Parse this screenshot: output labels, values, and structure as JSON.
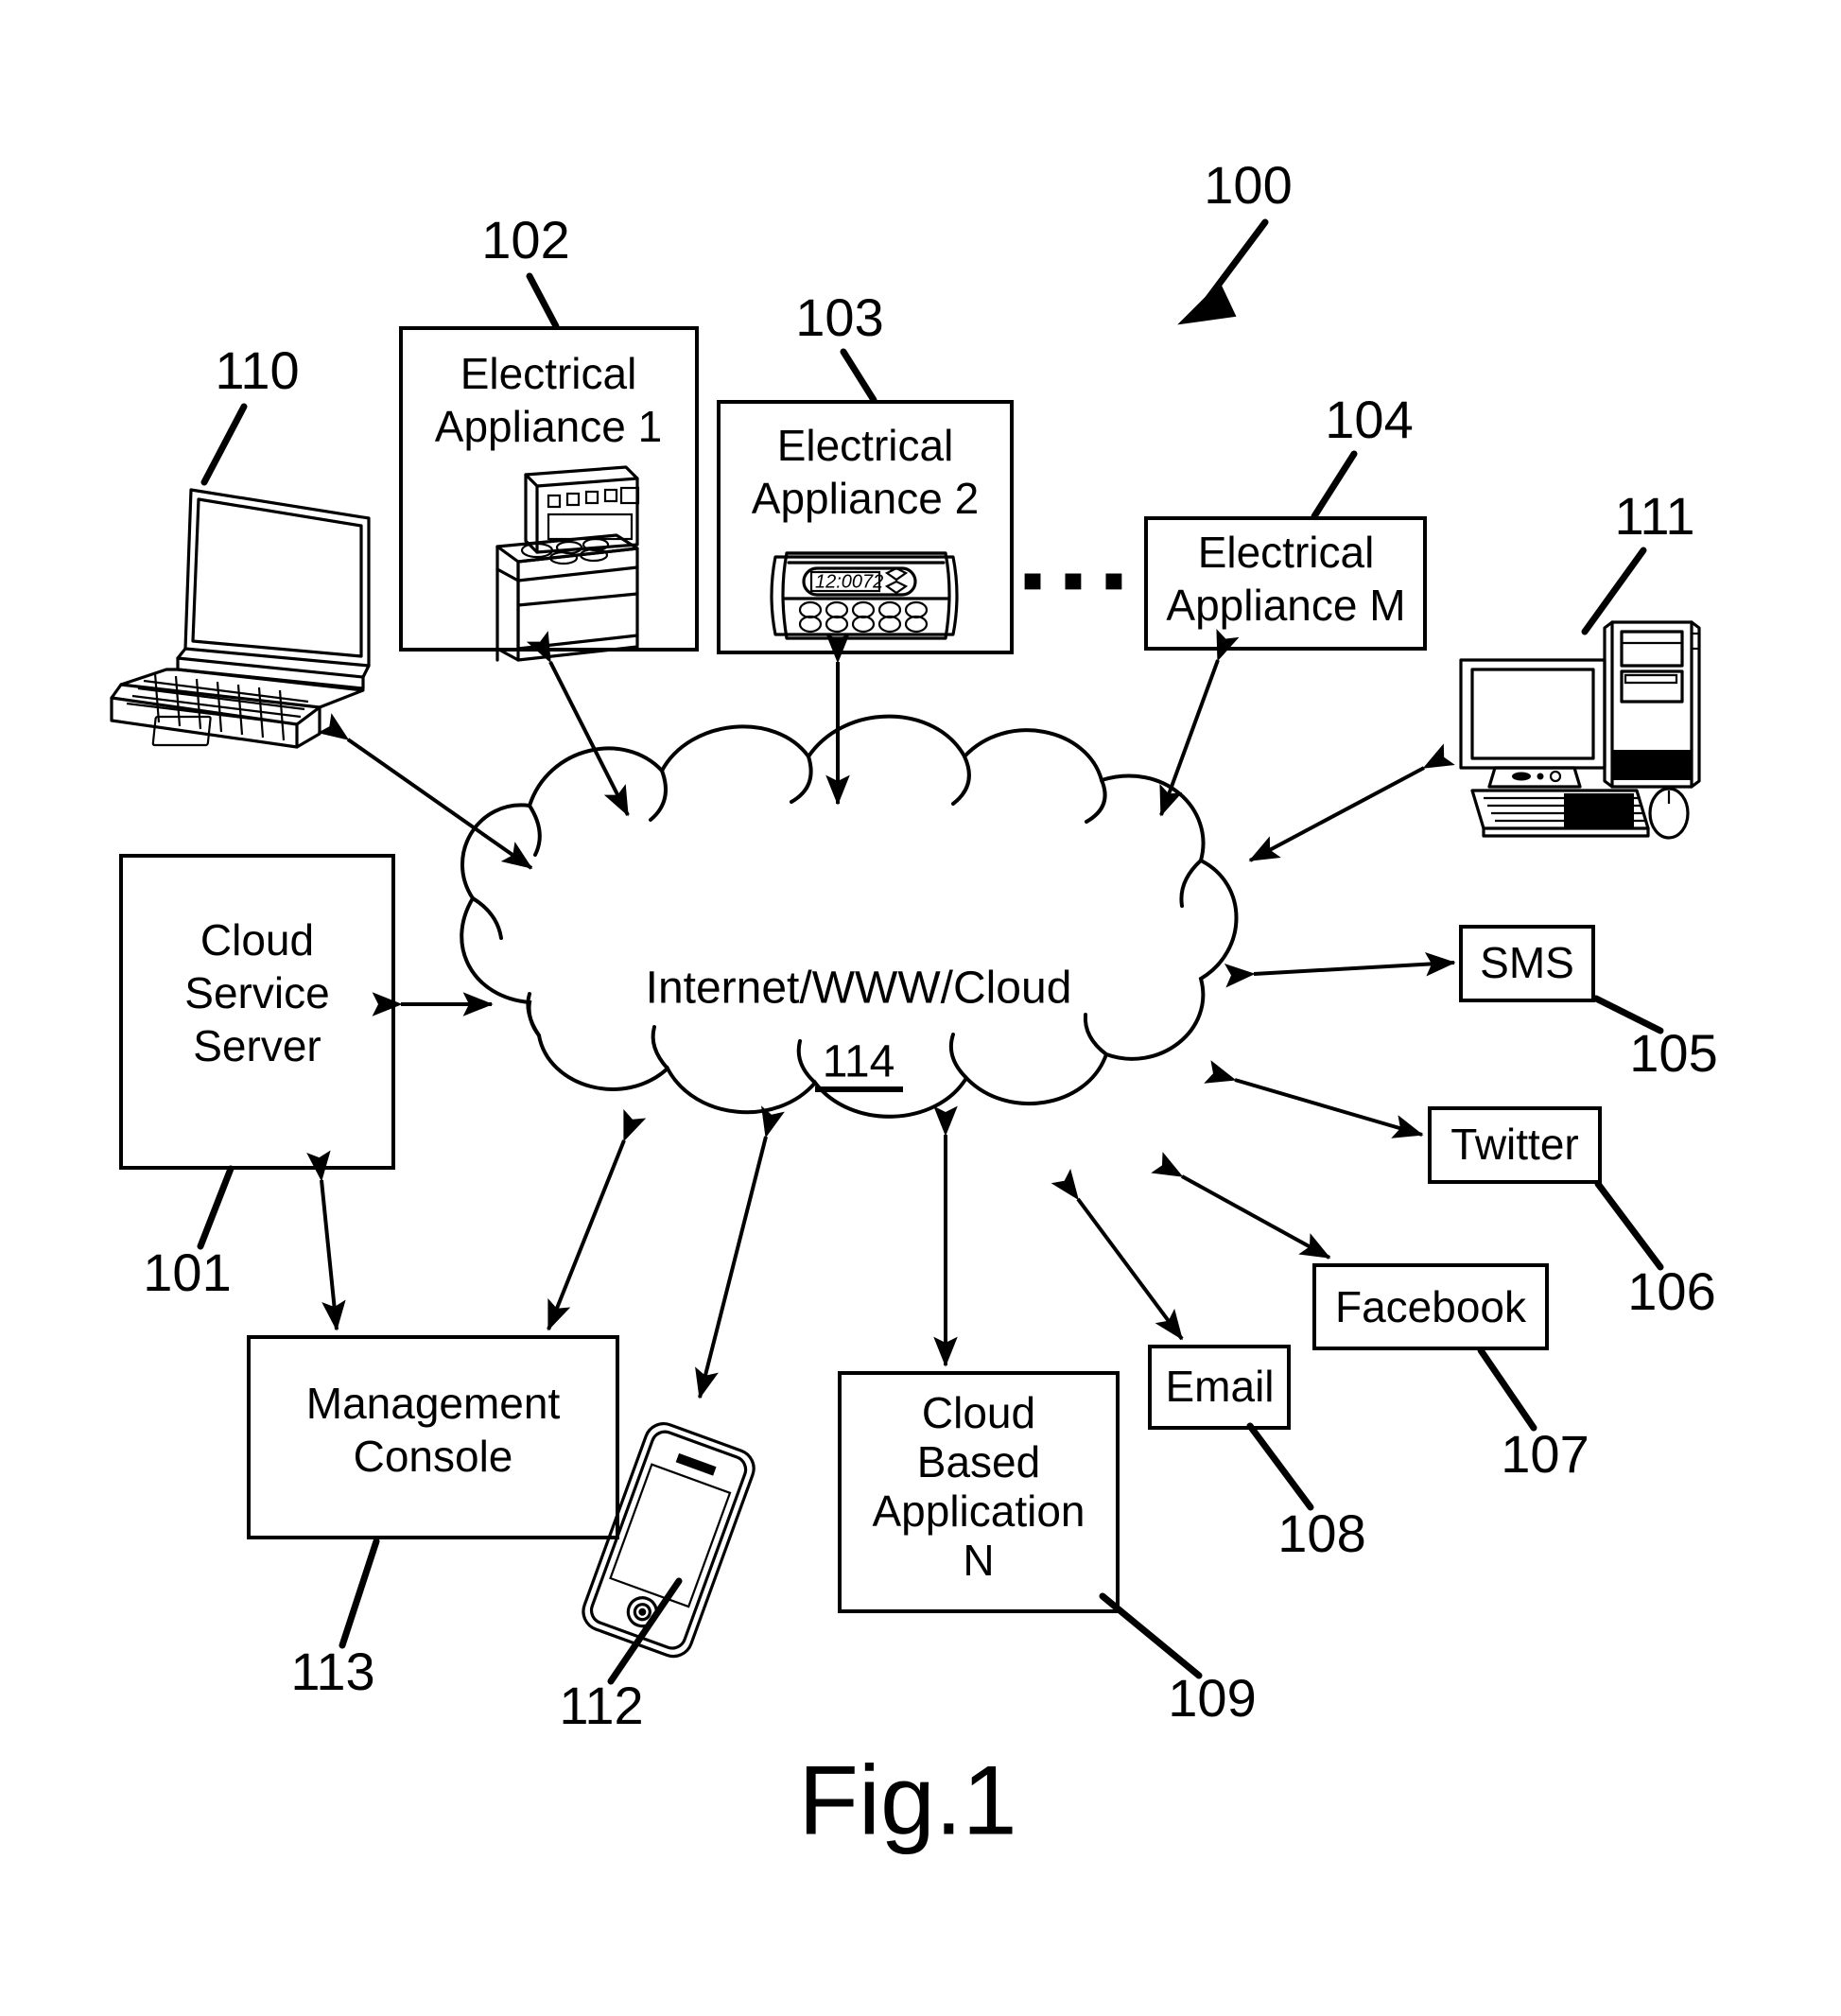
{
  "figure": {
    "caption": "Fig.1",
    "system_ref": "100"
  },
  "cloud": {
    "label": "Internet/WWW/Cloud",
    "ref": "114"
  },
  "nodes": [
    {
      "id": "appliance1",
      "label": "Electrical\nAppliance 1",
      "ref": "102",
      "icon": "stove-icon"
    },
    {
      "id": "appliance2",
      "label": "Electrical\nAppliance 2",
      "ref": "103",
      "icon": "thermostat-icon"
    },
    {
      "id": "applianceM",
      "label": "Electrical\nAppliance M",
      "ref": "104",
      "icon": "none"
    },
    {
      "id": "sms",
      "label": "SMS",
      "ref": "105",
      "icon": "none"
    },
    {
      "id": "twitter",
      "label": "Twitter",
      "ref": "106",
      "icon": "none"
    },
    {
      "id": "facebook",
      "label": "Facebook",
      "ref": "107",
      "icon": "none"
    },
    {
      "id": "email",
      "label": "Email",
      "ref": "108",
      "icon": "none"
    },
    {
      "id": "cloudapp",
      "label": "Cloud\nBased\nApplication\nN",
      "ref": "109",
      "icon": "none"
    },
    {
      "id": "server",
      "label": "Cloud\nService\nServer",
      "ref": "101",
      "icon": "none"
    },
    {
      "id": "console",
      "label": "Management\nConsole",
      "ref": "113",
      "icon": "none"
    },
    {
      "id": "laptop",
      "label": "",
      "ref": "110",
      "icon": "laptop-icon"
    },
    {
      "id": "desktop",
      "label": "",
      "ref": "111",
      "icon": "desktop-computer-icon"
    },
    {
      "id": "phone",
      "label": "",
      "ref": "112",
      "icon": "smartphone-icon"
    }
  ],
  "node_labels": {
    "appliance1_line1": "Electrical",
    "appliance1_line2": "Appliance 1",
    "appliance2_line1": "Electrical",
    "appliance2_line2": "Appliance 2",
    "applianceM_line1": "Electrical",
    "applianceM_line2": "Appliance M",
    "sms": "SMS",
    "twitter": "Twitter",
    "facebook": "Facebook",
    "email": "Email",
    "cloudapp_line1": "Cloud",
    "cloudapp_line2": "Based",
    "cloudapp_line3": "Application",
    "cloudapp_line4": "N",
    "server_line1": "Cloud",
    "server_line2": "Service",
    "server_line3": "Server",
    "console_line1": "Management",
    "console_line2": "Console"
  },
  "refs": {
    "r100": "100",
    "r101": "101",
    "r102": "102",
    "r103": "103",
    "r104": "104",
    "r105": "105",
    "r106": "106",
    "r107": "107",
    "r108": "108",
    "r109": "109",
    "r110": "110",
    "r111": "111",
    "r112": "112",
    "r113": "113",
    "r114": "114"
  },
  "ellipsis": "▪ ▪ ▪",
  "thermostat_display": {
    "time": "12:00",
    "temperature": "72"
  },
  "colors": {
    "ink": "#000000",
    "paper": "#ffffff"
  }
}
